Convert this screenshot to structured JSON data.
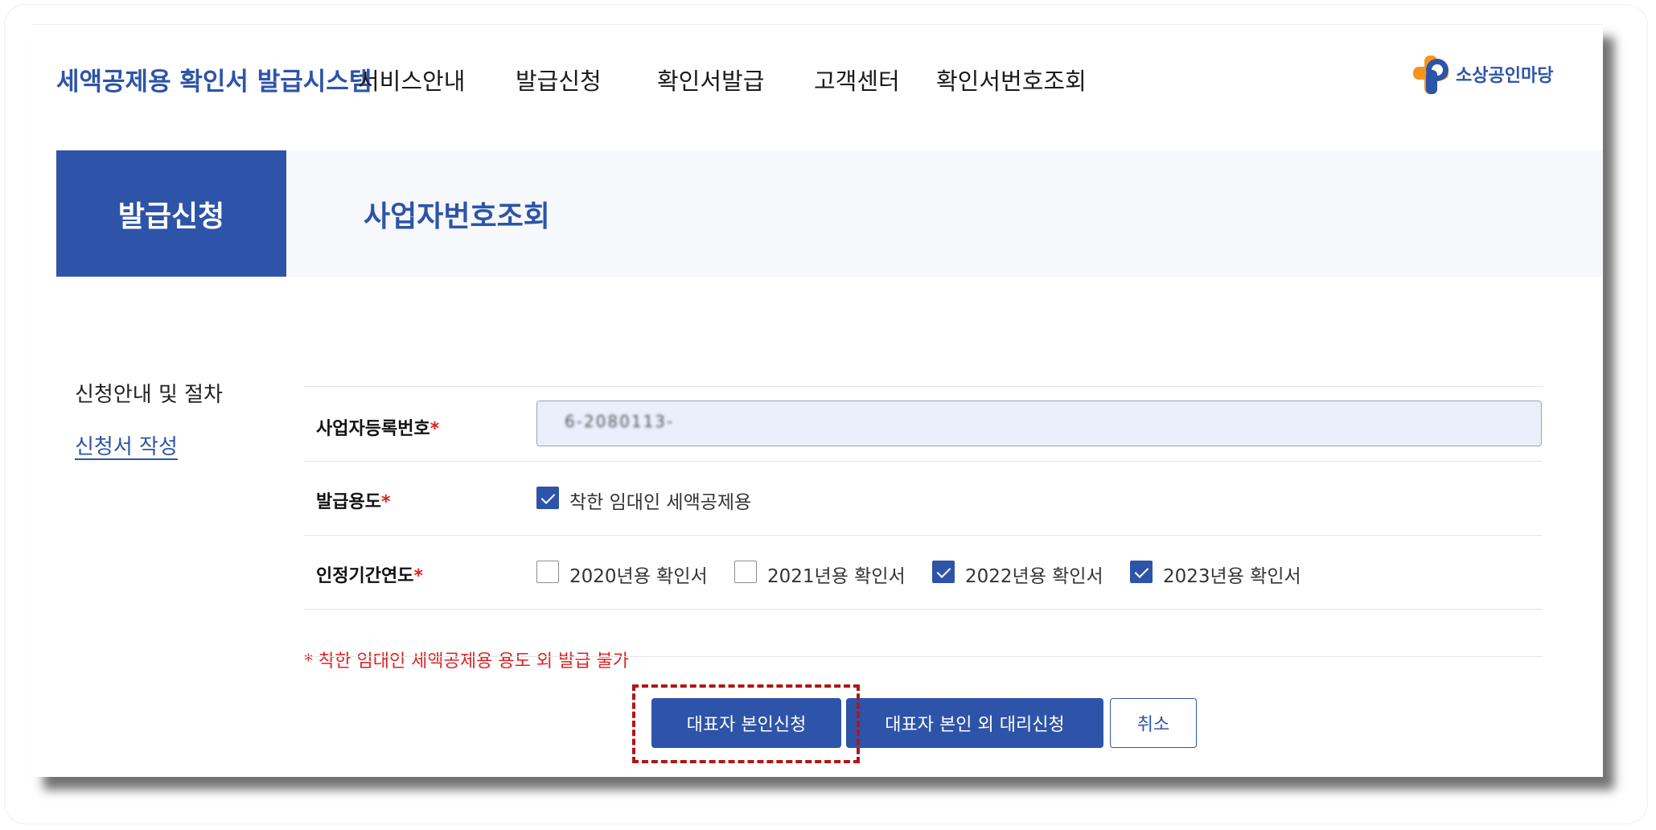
{
  "header": {
    "site_title": "세액공제용 확인서 발급시스템",
    "nav": [
      "서비스안내",
      "발급신청",
      "확인서발급",
      "고객센터",
      "확인서번호조회"
    ],
    "logo_text": "소상공인마당"
  },
  "tabs": {
    "active": "발급신청",
    "second": "사업자번호조회"
  },
  "side_menu": {
    "items": [
      "신청안내 및 절차",
      "신청서 작성"
    ]
  },
  "form": {
    "required_mark": "*",
    "business_number": {
      "label": "사업자등록번호",
      "value": "6-2080113-"
    },
    "purpose": {
      "label": "발급용도",
      "option": "착한 임대인 세액공제용",
      "checked": true
    },
    "years": {
      "label": "인정기간연도",
      "options": [
        {
          "label": "2020년용 확인서",
          "checked": false
        },
        {
          "label": "2021년용 확인서",
          "checked": false
        },
        {
          "label": "2022년용 확인서",
          "checked": true
        },
        {
          "label": "2023년용 확인서",
          "checked": true
        }
      ]
    },
    "notice": "* 착한 임대인 세액공제용 용도 외 발급 불가"
  },
  "buttons": {
    "self_apply": "대표자 본인신청",
    "proxy_apply": "대표자 본인 외 대리신청",
    "cancel": "취소"
  },
  "colors": {
    "brand_blue": "#2e54a9",
    "input_bg": "#e9f0fc",
    "required_red": "#e02020",
    "highlight_red": "#b01616",
    "logo_orange": "#f7941d"
  }
}
